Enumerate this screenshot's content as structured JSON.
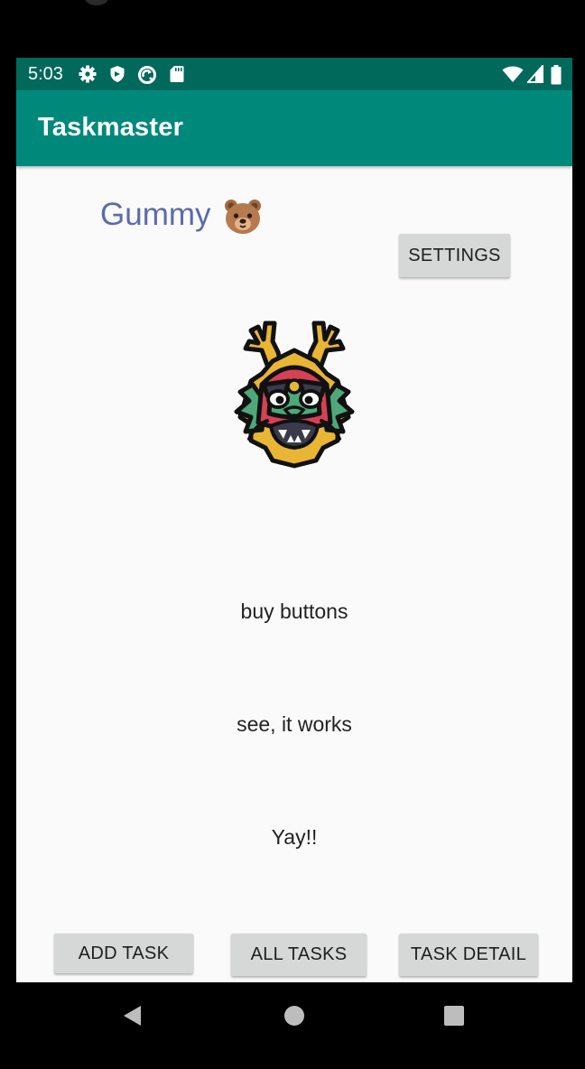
{
  "status_bar": {
    "time": "5:03",
    "left_icons": [
      "gear-icon",
      "shield-icon",
      "sync-icon",
      "sd-card-icon"
    ],
    "right_icons": [
      "wifi-icon",
      "signal-icon",
      "battery-icon"
    ]
  },
  "app_bar": {
    "title": "Taskmaster"
  },
  "header": {
    "username": "Gummy",
    "username_icon": "bear-face-icon",
    "settings_label": "SETTINGS"
  },
  "image": {
    "icon": "dragon-mask-icon"
  },
  "tasks": [
    {
      "title": "buy buttons"
    },
    {
      "title": "see, it works"
    },
    {
      "title": "Yay!!"
    }
  ],
  "bottom_buttons": {
    "add_task": "ADD TASK",
    "all_tasks": "ALL TASKS",
    "task_detail": "TASK DETAIL"
  },
  "nav_bar": {
    "icons": [
      "back-icon",
      "home-icon",
      "recents-icon"
    ]
  },
  "colors": {
    "status_bar": "#00695c",
    "app_bar": "#00897b",
    "username": "#5c6bab",
    "button": "#d6d7d7",
    "background": "#fafafa"
  }
}
